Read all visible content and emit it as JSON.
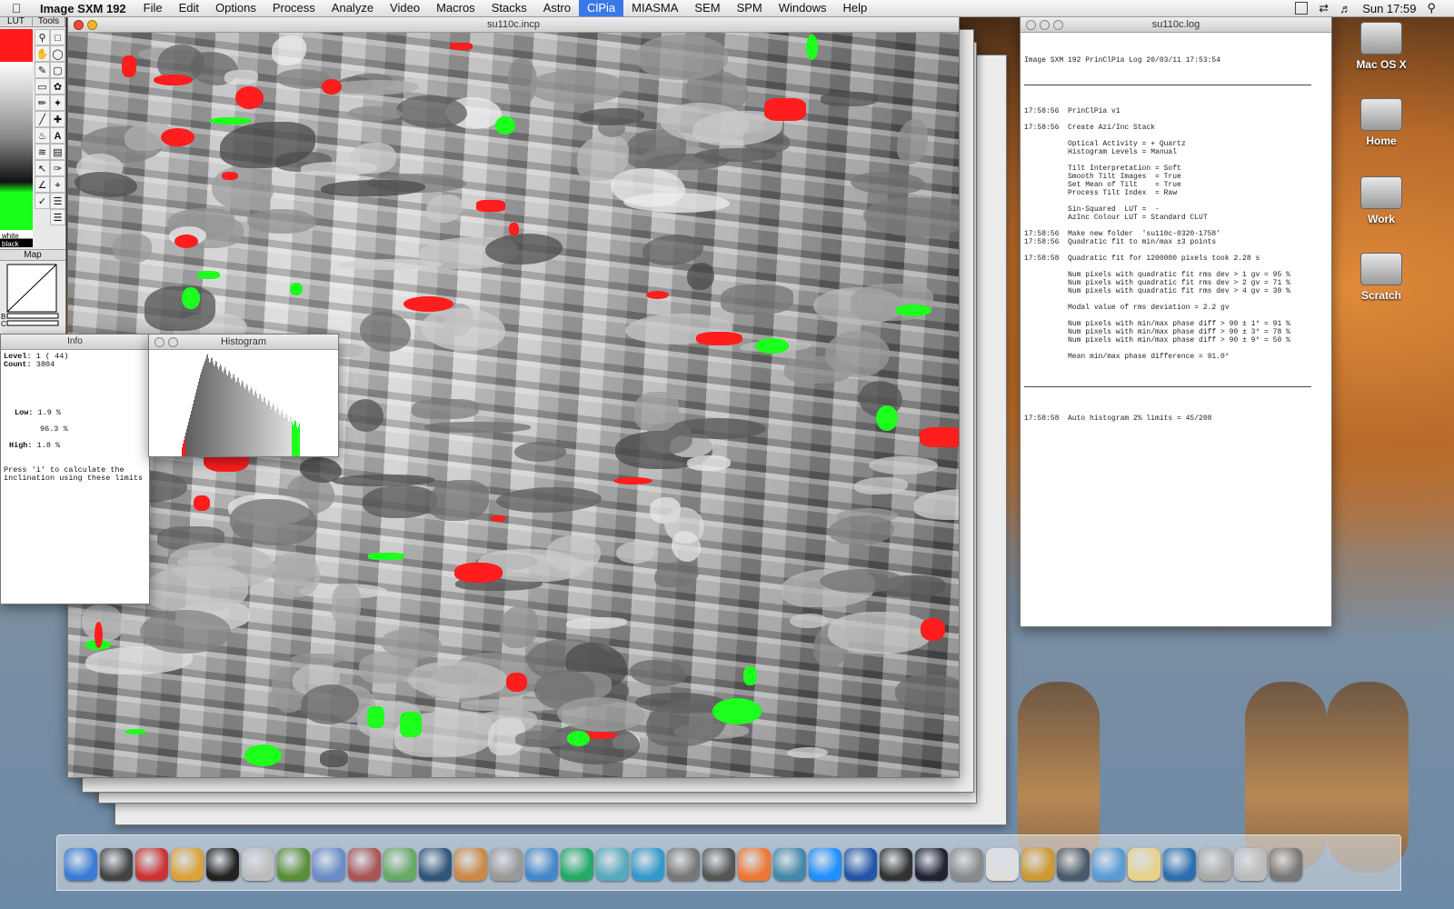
{
  "menubar": {
    "app_name": "Image SXM 192",
    "items": [
      "File",
      "Edit",
      "Options",
      "Process",
      "Analyze",
      "Video",
      "Macros",
      "Stacks",
      "Astro",
      "ClPia",
      "MIASMA",
      "SEM",
      "SPM",
      "Windows",
      "Help"
    ],
    "active_item": "ClPia",
    "clock": "Sun 17:59"
  },
  "tools": {
    "lut_label": "LUT",
    "tools_label": "Tools",
    "white_label": "white",
    "black_label": "black",
    "map_label": "Map",
    "map_b": "B",
    "map_c": "C"
  },
  "image_window": {
    "title": "su110c.incp"
  },
  "info_window": {
    "title": "Info",
    "level_label": "Level:",
    "level_value": "1  ( 44)",
    "count_label": "Count:",
    "count_value": "3804",
    "low_label": "Low:",
    "low_value": "1.9 %",
    "mid_value": "96.3 %",
    "high_label": "High:",
    "high_value": "1.8 %",
    "hint": "Press 'i' to calculate the\ninclination using these limits"
  },
  "histogram_window": {
    "title": "Histogram"
  },
  "log_window": {
    "title": "su110c.log",
    "header": "Image SXM 192 PrinClPia Log 20/03/11 17:53:54",
    "lines": [
      "17:58:56  PrinClPia v1",
      "",
      "17:58:56  Create Azi/Inc Stack",
      "",
      "          Optical Activity = + Quartz",
      "          Histogram Levels = Manual",
      "",
      "          Tilt Interpretation = Soft",
      "          Smooth Tilt Images  = True",
      "          Set Mean of Tilt    = True",
      "          Process Tilt Index  = Raw",
      "",
      "          Sin-Squared  LUT =  -",
      "          AzInc Colour LUT = Standard CLUT",
      "",
      "17:58:56  Make new folder  'su110c-0320-1758'",
      "17:58:56  Quadratic fit to min/max ±3 points",
      "",
      "17:58:58  Quadratic fit for 1200000 pixels took 2.28 s",
      "",
      "          Num pixels with quadratic fit rms dev > 1 gv = 95 %",
      "          Num pixels with quadratic fit rms dev > 2 gv = 71 %",
      "          Num pixels with quadratic fit rms dev > 4 gv = 30 %",
      "",
      "          Modal value of rms deviation = 2.2 gv",
      "",
      "          Num pixels with min/max phase diff > 90 ± 1° = 91 %",
      "          Num pixels with min/max phase diff > 90 ± 3° = 78 %",
      "          Num pixels with min/max phase diff > 90 ± 9° = 50 %",
      "",
      "          Mean min/max phase difference = 91.0°"
    ],
    "footer": "17:58:58  Auto histogram 2% limits = 45/208"
  },
  "desktop_icons": [
    "Mac OS X",
    "Home",
    "Work",
    "Scratch"
  ],
  "dock": {
    "icons": [
      "finder-icon",
      "dashboard-icon",
      "acrobat-icon",
      "textedit-icon",
      "blackberry-icon",
      "calculator-icon",
      "installer-icon",
      "preview-icon",
      "script-icon",
      "automator-icon",
      "network-icon",
      "photos-icon",
      "scanner-icon",
      "imovie-icon",
      "iphoto-icon",
      "itunes-icon",
      "grapher-icon",
      "pen-icon",
      "camera-icon",
      "powerpoint-icon",
      "pictures-icon",
      "safari-icon",
      "thunderbird-icon",
      "space-icon",
      "night-icon",
      "preferences-icon",
      "pencil-icon",
      "utility-icon",
      "timemachine-icon",
      "mail-icon",
      "fontbook-icon",
      "xcode-icon",
      "scanner2-icon",
      "scanner3-icon",
      "trash-icon"
    ]
  },
  "colors": {
    "accent": "#3b78e7",
    "low_overlay": "#ff1d1d",
    "high_overlay": "#1dff1d"
  }
}
